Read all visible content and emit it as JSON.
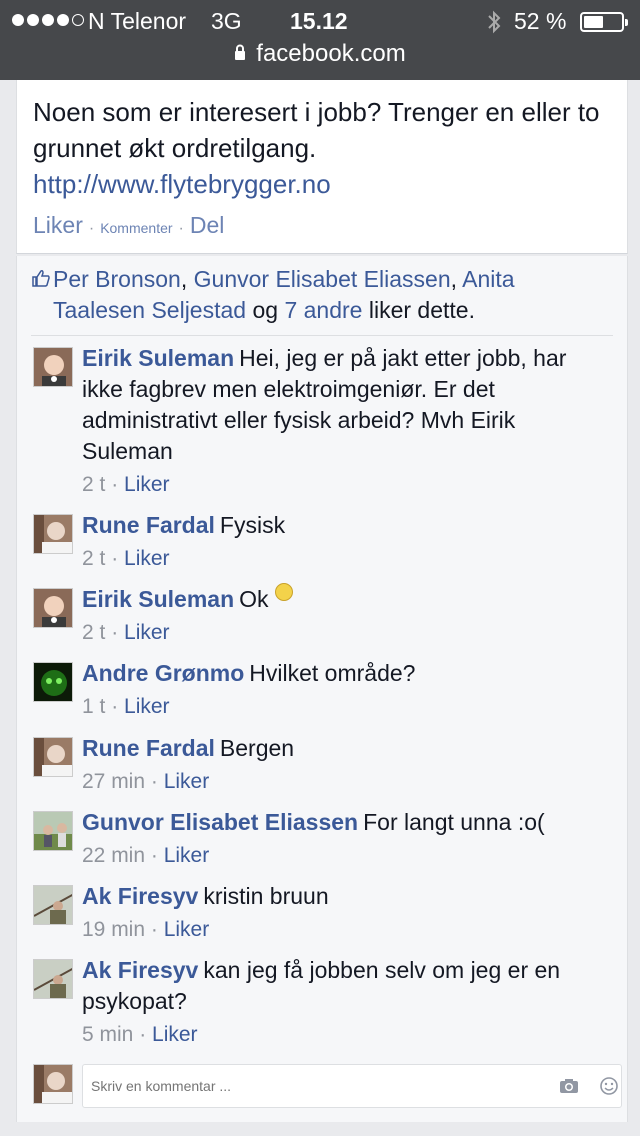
{
  "status_bar": {
    "carrier": "N Telenor",
    "network": "3G",
    "time": "15.12",
    "battery_text": "52 %",
    "battery_level": 0.52,
    "signal_bars_filled": 4,
    "signal_bars_total": 5
  },
  "url_bar": {
    "domain": "facebook.com"
  },
  "post": {
    "text": "Noen som er interesert i jobb? Trenger en eller to grunnet økt ordretilgang.",
    "link": "http://www.flytebrygger.no",
    "actions": {
      "like": "Liker",
      "comment": "Kommenter",
      "share": "Del",
      "separator": "·"
    }
  },
  "likes": {
    "names": [
      "Per Bronson",
      "Gunvor Elisabet Eliassen",
      "Anita Taalesen Seljestad"
    ],
    "comma": ",",
    "og": "og",
    "others": "7 andre",
    "suffix": "liker dette."
  },
  "comments": [
    {
      "author": "Eirik Suleman",
      "text": "Hei, jeg er på jakt etter jobb, har ikke fagbrev men elektroimgeniør. Er det administrativt eller fysisk arbeid? Mvh Eirik Suleman",
      "time": "2 t",
      "like": "Liker",
      "avatar": "baby-photo"
    },
    {
      "author": "Rune Fardal",
      "text": "Fysisk",
      "time": "2 t",
      "like": "Liker",
      "avatar": "man-photo"
    },
    {
      "author": "Eirik Suleman",
      "text": "Ok",
      "time": "2 t",
      "like": "Liker",
      "avatar": "baby-photo",
      "emoji": "smile"
    },
    {
      "author": "Andre Grønmo",
      "text": "Hvilket område?",
      "time": "1 t",
      "like": "Liker",
      "avatar": "green-photo"
    },
    {
      "author": "Rune Fardal",
      "text": "Bergen",
      "time": "27 min",
      "like": "Liker",
      "avatar": "man-photo"
    },
    {
      "author": "Gunvor Elisabet Eliassen",
      "text": "For langt unna :o(",
      "time": "22 min",
      "like": "Liker",
      "avatar": "outdoor-photo"
    },
    {
      "author": "Ak Firesyv",
      "text": "kristin bruun",
      "time": "19 min",
      "like": "Liker",
      "avatar": "hunter-photo"
    },
    {
      "author": "Ak Firesyv",
      "text": "kan jeg få jobben selv om jeg er en psykopat?",
      "time": "5 min",
      "like": "Liker",
      "avatar": "hunter-photo"
    }
  ],
  "composer": {
    "placeholder": "Skriv en kommentar ..."
  },
  "colors": {
    "link": "#3b5998",
    "status_bar": "#46484b",
    "background": "#e9eaed"
  }
}
